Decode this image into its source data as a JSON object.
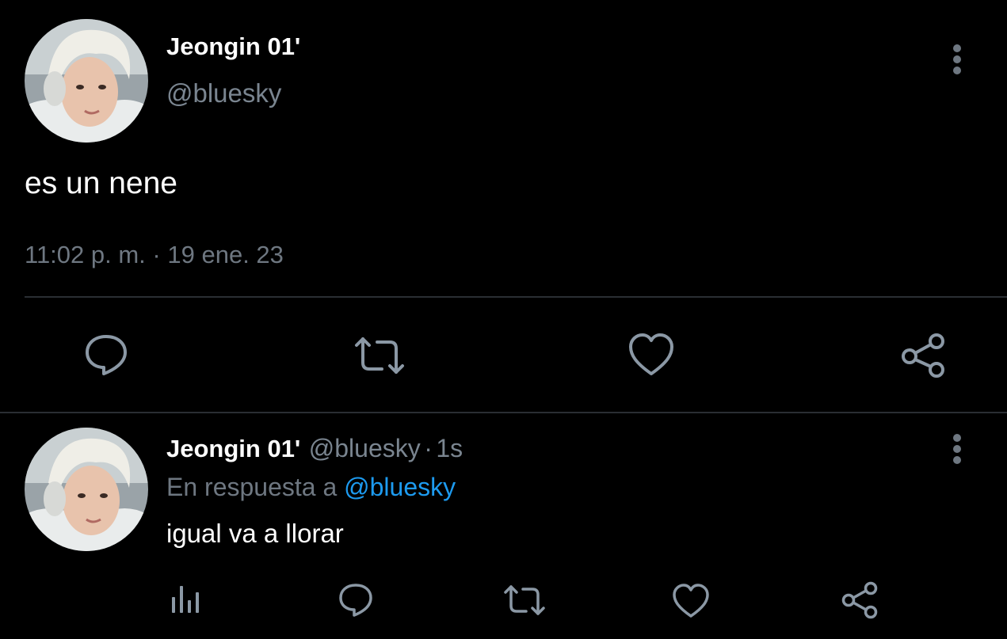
{
  "main_tweet": {
    "display_name": "Jeongin 01'",
    "handle": "@bluesky",
    "text": "es un nene",
    "time": "11:02 p. m.",
    "separator": "·",
    "date": "19 ene. 23",
    "actions": {
      "reply_icon": "speech-bubble-icon",
      "retweet_icon": "retweet-arrows-icon",
      "like_icon": "heart-icon",
      "share_icon": "share-nodes-icon"
    }
  },
  "reply_tweet": {
    "display_name": "Jeongin 01'",
    "handle": "@bluesky",
    "separator": "·",
    "age": "1s",
    "reply_prefix": "En respuesta a",
    "reply_to": "@bluesky",
    "text": "igual va a llorar",
    "actions": {
      "analytics_icon": "bar-chart-icon",
      "reply_icon": "speech-bubble-icon",
      "retweet_icon": "retweet-arrows-icon",
      "like_icon": "heart-icon",
      "share_icon": "share-nodes-icon"
    }
  },
  "colors": {
    "background": "#000000",
    "primary_text": "#ffffff",
    "secondary_text": "#6e7781",
    "icon": "#8b98a5",
    "link": "#1d9bf0",
    "divider": "#2a2e33"
  }
}
